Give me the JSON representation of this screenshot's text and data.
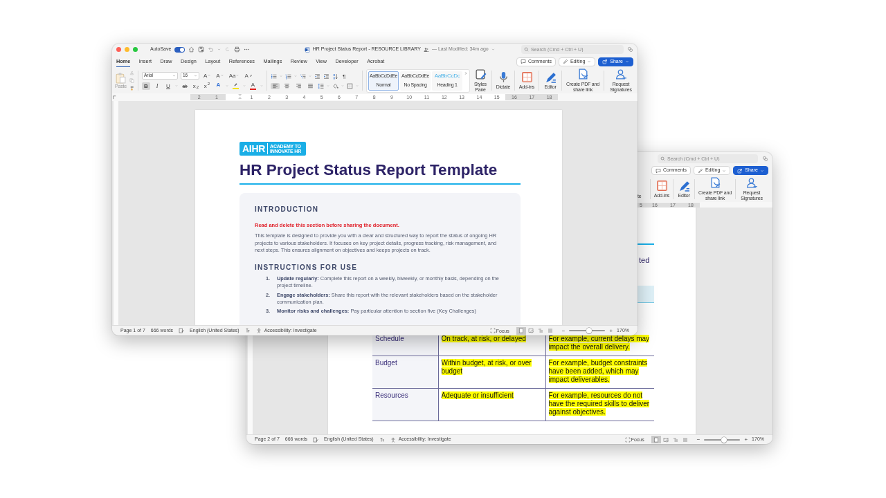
{
  "front_window": {
    "title_bar": {
      "autosave": {
        "label": "AutoSave",
        "on": true
      },
      "title": "HR Project Status Report - RESOURCE LIBRARY",
      "modified": "— Last Modified: 34m ago",
      "search": {
        "placeholder": "Search (Cmd + Ctrl + U)"
      }
    },
    "tabs": [
      {
        "label": "Home",
        "selected": true
      },
      {
        "label": "Insert",
        "selected": false
      },
      {
        "label": "Draw",
        "selected": false
      },
      {
        "label": "Design",
        "selected": false
      },
      {
        "label": "Layout",
        "selected": false
      },
      {
        "label": "References",
        "selected": false
      },
      {
        "label": "Mailings",
        "selected": false
      },
      {
        "label": "Review",
        "selected": false
      },
      {
        "label": "View",
        "selected": false
      },
      {
        "label": "Developer",
        "selected": false
      },
      {
        "label": "Acrobat",
        "selected": false
      }
    ],
    "actions": {
      "comments": "Comments",
      "editing": "Editing",
      "share": "Share"
    },
    "ribbon": {
      "paste_label": "Paste",
      "font": "Arial",
      "font_size": "16",
      "font_buttons": [
        {
          "kind": "grow",
          "label": "A"
        },
        {
          "kind": "shrink",
          "label": "A"
        },
        {
          "kind": "case",
          "label": "Aa"
        },
        {
          "kind": "clear",
          "label": "A"
        }
      ],
      "format_buttons": [
        {
          "kind": "bold",
          "label": "B",
          "on": true
        },
        {
          "kind": "italic",
          "label": "I",
          "on": false
        },
        {
          "kind": "underline",
          "label": "U",
          "on": false
        },
        {
          "kind": "strike",
          "label": "ab",
          "on": false
        },
        {
          "kind": "subscript",
          "label": "x$_{2}$",
          "on": false
        },
        {
          "kind": "superscript",
          "label": "x$^{2}$",
          "on": false
        }
      ],
      "color_buttons": [
        {
          "kind": "effects",
          "label": "A",
          "color": "#2f6fd6"
        },
        {
          "kind": "highlight",
          "color": "#f5e400"
        },
        {
          "kind": "font_color",
          "label": "A",
          "color": "#e0201c"
        }
      ],
      "paragraph_buttons": [
        {
          "kind": "bullets"
        },
        {
          "kind": "numbering"
        },
        {
          "kind": "multilevel"
        },
        {
          "kind": "outdent"
        },
        {
          "kind": "indent"
        },
        {
          "kind": "sort"
        },
        {
          "kind": "marks",
          "label": "¶"
        }
      ],
      "align_buttons": [
        {
          "kind": "left",
          "selected": true
        },
        {
          "kind": "center",
          "selected": false
        },
        {
          "kind": "right",
          "selected": false
        },
        {
          "kind": "justify",
          "selected": false
        }
      ],
      "paragraph_buttons_2": [
        {
          "kind": "spacing"
        },
        {
          "kind": "shading"
        },
        {
          "kind": "borders"
        }
      ],
      "styles": [
        {
          "kind": "normal",
          "preview": "AaBbCcDdEe",
          "label": "Normal",
          "selected": true
        },
        {
          "kind": "normal",
          "preview": "AaBbCcDdEe",
          "label": "No Spacing",
          "selected": false
        },
        {
          "kind": "heading",
          "preview": "AaBbCcDc",
          "label": "Heading 1",
          "selected": false
        }
      ],
      "tools": [
        {
          "kind": "styles_pane",
          "label": "Styles Pane"
        },
        {
          "kind": "dictate",
          "label": "Dictate"
        },
        {
          "kind": "addins",
          "label": "Add-ins"
        },
        {
          "kind": "editor",
          "label": "Editor"
        },
        {
          "kind": "pdf",
          "label": "Create PDF and share link"
        },
        {
          "kind": "signatures",
          "label": "Request Signatures"
        }
      ]
    },
    "ruler_labels": [
      "2",
      "1",
      "1",
      "2",
      "3",
      "4",
      "5",
      "6",
      "7",
      "8",
      "9",
      "10",
      "11",
      "12",
      "13",
      "14",
      "15",
      "16",
      "17",
      "18"
    ],
    "document": {
      "logo": {
        "mark": "AIHR",
        "tagline": "ACADEMY TO INNOVATE HR"
      },
      "title": "HR Project Status Report Template",
      "sections": [
        {
          "heading": "INTRODUCTION",
          "warning": "Read and delete this section before sharing the document.",
          "paragraph": "This template is designed to provide you with a clear and structured way to report the status of ongoing HR projects to various stakeholders. It focuses on key project details, progress tracking, risk management, and next steps. This ensures alignment on objectives and keeps projects on track."
        },
        {
          "heading": "INSTRUCTIONS FOR USE",
          "items": [
            {
              "number": "1.",
              "text": "**Update regularly:** Complete this report on a weekly, biweekly, or monthly basis, depending on the project timeline."
            },
            {
              "number": "2.",
              "text": "**Engage stakeholders:** Share this report with the relevant stakeholders based on the stakeholder communication plan."
            },
            {
              "number": "3.",
              "text": "**Monitor risks and challenges:** Pay particular attention to section five (Key Challenges)"
            }
          ]
        }
      ]
    },
    "status_bar": {
      "page": "Page 1 of 7",
      "words": "666 words",
      "language": "English (United States)",
      "accessibility": "Accessibility: Investigate",
      "focus": "Focus",
      "views": [
        {
          "kind": "print",
          "selected": true
        },
        {
          "kind": "web",
          "selected": false
        },
        {
          "kind": "outline",
          "selected": false
        },
        {
          "kind": "draft",
          "selected": false
        }
      ],
      "zoom": {
        "minus": "−",
        "plus": "+",
        "level": 0.55,
        "reading": "170%"
      }
    }
  },
  "back_window": {
    "search": {
      "placeholder": "Search (Cmd + Ctrl + U)"
    },
    "actions": {
      "comments": "Comments",
      "editing": "Editing",
      "share": "Share"
    },
    "tools": [
      {
        "kind": "fragment",
        "label": "te"
      },
      {
        "kind": "addins",
        "label": "Add-ins"
      },
      {
        "kind": "editor",
        "label": "Editor"
      },
      {
        "kind": "pdf",
        "label": "Create PDF and share link"
      },
      {
        "kind": "signatures",
        "label": "Request Signatures"
      }
    ],
    "ruler_labels": [
      "5",
      "16",
      "17",
      "18"
    ],
    "document": {
      "heading_fragment": "ted",
      "table": {
        "rows": [
          {
            "cells": [
              "Schedule",
              "On track, at risk, or delayed",
              "For example, current delays may impact the overall delivery."
            ]
          },
          {
            "cells": [
              "Budget",
              "Within budget, at risk, or over budget",
              "For example, budget constraints have been added, which may impact deliverables."
            ]
          },
          {
            "cells": [
              "Resources",
              "Adequate or insufficient",
              "For example, resources do not have the required skills to deliver against objectives."
            ]
          }
        ]
      }
    },
    "status_bar": {
      "page": "Page 2 of 7",
      "words": "666 words",
      "language": "English (United States)",
      "accessibility": "Accessibility: Investigate",
      "focus": "Focus",
      "views": [
        {
          "kind": "print",
          "selected": true
        },
        {
          "kind": "web",
          "selected": false
        },
        {
          "kind": "outline",
          "selected": false
        },
        {
          "kind": "draft",
          "selected": false
        }
      ],
      "zoom": {
        "minus": "−",
        "plus": "+",
        "level": 0.55,
        "reading": "170%"
      }
    }
  }
}
